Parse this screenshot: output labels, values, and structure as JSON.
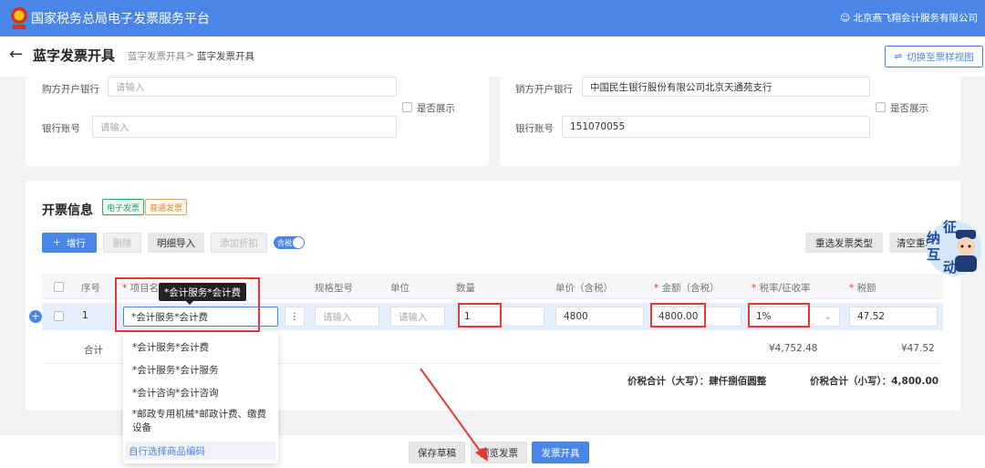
{
  "app": {
    "title": "国家税务总局电子发票服务平台",
    "user": "北京燕飞翔会计服务有限公司"
  },
  "header": {
    "back_icon": "←",
    "title": "蓝字发票开具",
    "breadcrumb": [
      "蓝字发票开具",
      "蓝字发票开具"
    ],
    "separator": ">",
    "switch_label": "切换至票样视图"
  },
  "buyer": {
    "bank_label": "购方开户银行",
    "bank_placeholder": "请输入",
    "account_label": "银行账号",
    "account_placeholder": "请输入",
    "show_label": "是否展示"
  },
  "seller": {
    "bank_label": "销方开户银行",
    "bank_value": "中国民生银行股份有限公司北京天通苑支行",
    "account_label": "银行账号",
    "account_value": "151070055",
    "show_label": "是否展示"
  },
  "invoice": {
    "title": "开票信息",
    "tags": [
      "电子发票",
      "普通发票"
    ],
    "buttons": {
      "add": "增行",
      "delete": "删除",
      "import": "明细导入",
      "discount": "添加折扣",
      "tax_toggle": "含税",
      "reselect": "重选发票类型",
      "clear": "清空重填"
    },
    "columns": [
      "序号",
      "项目名称",
      "规格型号",
      "单位",
      "数量",
      "单价（含税）",
      "金额（含税）",
      "税率/征收率",
      "税额"
    ],
    "row": {
      "index": "1",
      "item": "*会计服务*会计费",
      "spec_placeholder": "请输入",
      "unit_placeholder": "请输入",
      "qty": "1",
      "price": "4800",
      "amount": "4800.00",
      "rate": "1%",
      "tax": "47.52"
    },
    "total_label": "合计",
    "total_amount": "¥4,752.48",
    "total_tax": "¥47.52",
    "total_upper_label": "价税合计（大写）：",
    "total_upper": "肆仟捌佰圆整",
    "total_lower_label": "价税合计（小写）：",
    "total_lower": "4,800.00",
    "tooltip": "*会计服务*会计费",
    "dropdown": [
      "*会计服务*会计费",
      "*会计服务*会计服务",
      "*会计咨询*会计咨询",
      "*邮政专用机械*邮政计费、缴费设备"
    ],
    "dropdown_link": "自行选择商品编码"
  },
  "badge": {
    "chars": [
      "征",
      "纳",
      "互",
      "动"
    ]
  },
  "footer": {
    "save": "保存草稿",
    "preview": "预览发票",
    "issue": "发票开具"
  },
  "colors": {
    "primary": "#4a86e8",
    "highlight": "#e53935"
  }
}
